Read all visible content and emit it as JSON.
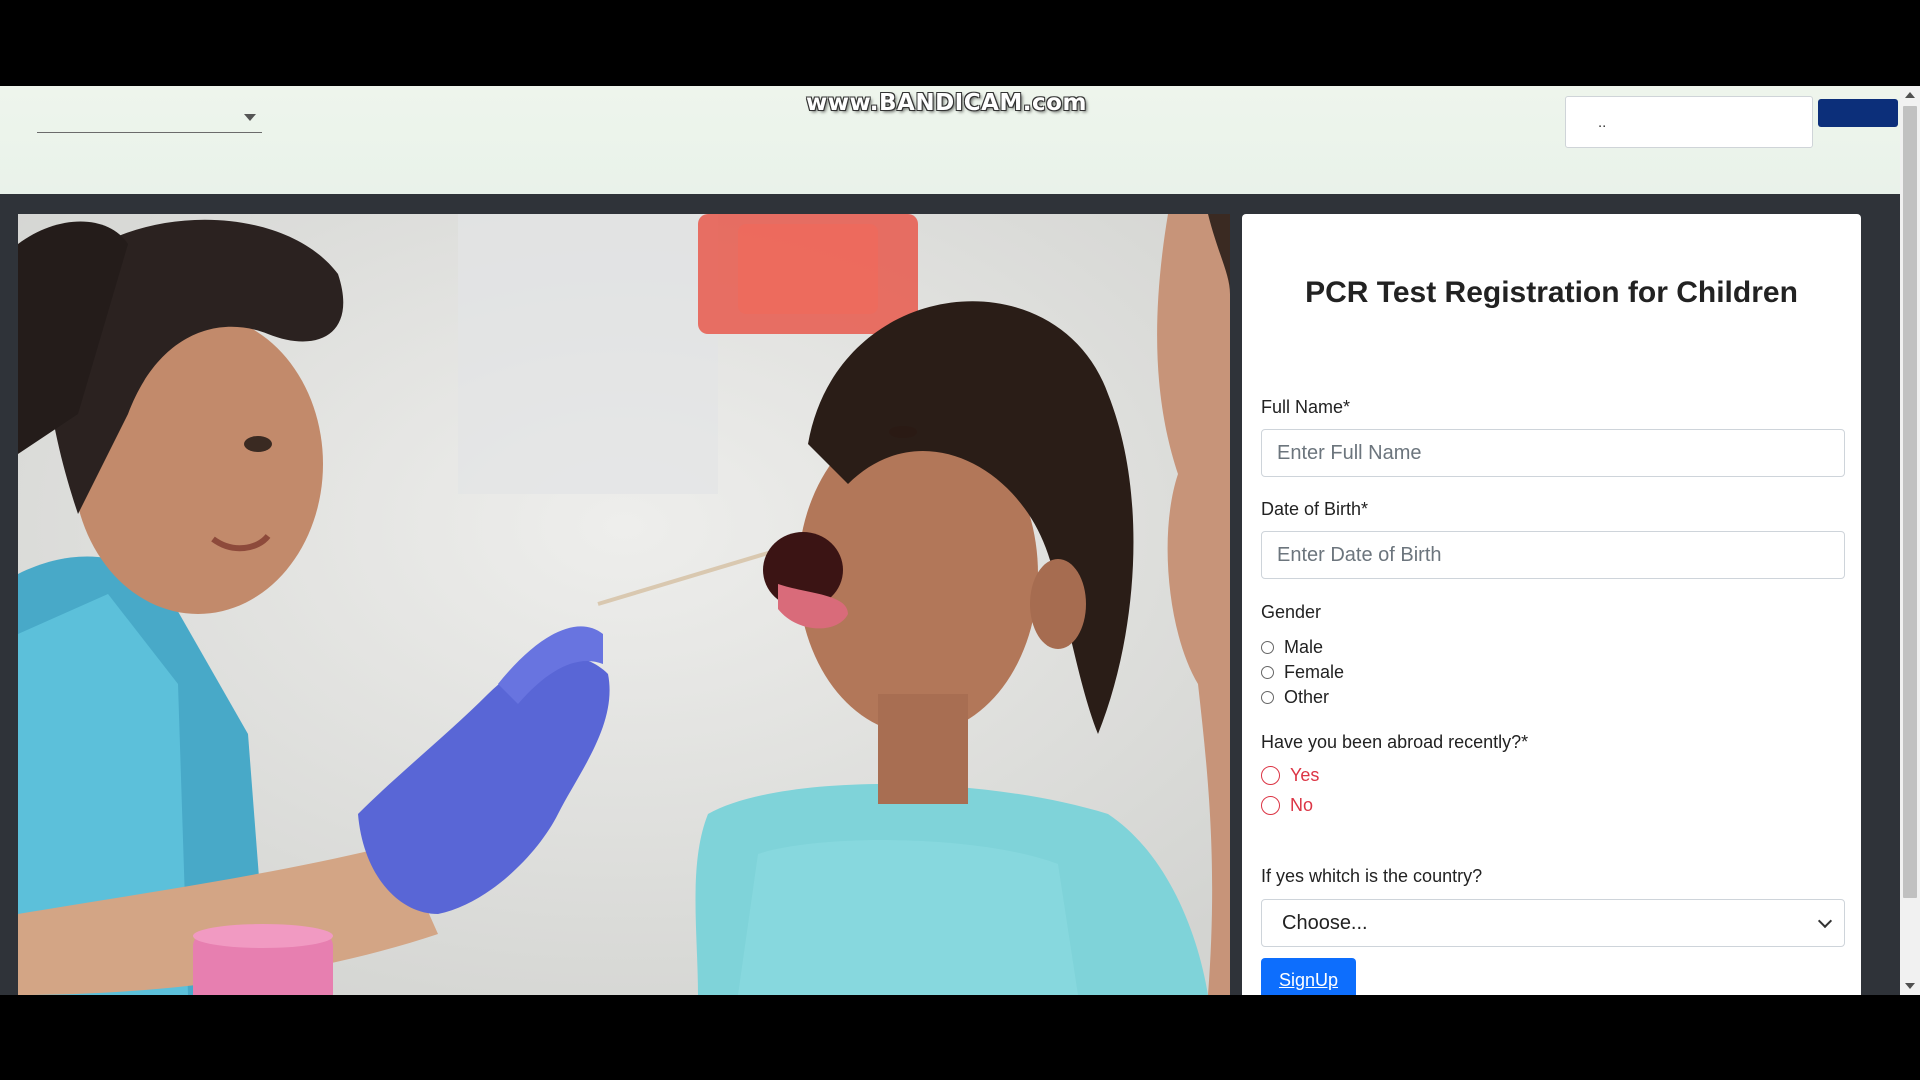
{
  "watermark": "www.BANDICAM.com",
  "navbar": {
    "dropdown_value": "",
    "search_placeholder": "..",
    "search_button_label": ""
  },
  "form": {
    "title": "PCR Test Registration for Children",
    "full_name_label": "Full Name*",
    "full_name_placeholder": "Enter Full Name",
    "dob_label": "Date of Birth*",
    "dob_placeholder": "Enter Date of Birth",
    "gender_label": "Gender",
    "gender_options": [
      "Male",
      "Female",
      "Other"
    ],
    "abroad_label": "Have you been abroad recently?*",
    "abroad_options": [
      "Yes",
      "No"
    ],
    "country_label": "If yes whitch is the country?",
    "country_selected": "Choose...",
    "submit_label": "SignUp"
  },
  "colors": {
    "navbar_bg": "#eef5ec",
    "page_bg": "#2f3339",
    "primary": "#0d6efd",
    "nav_button": "#0c2f7a",
    "invalid": "#dc3545"
  }
}
